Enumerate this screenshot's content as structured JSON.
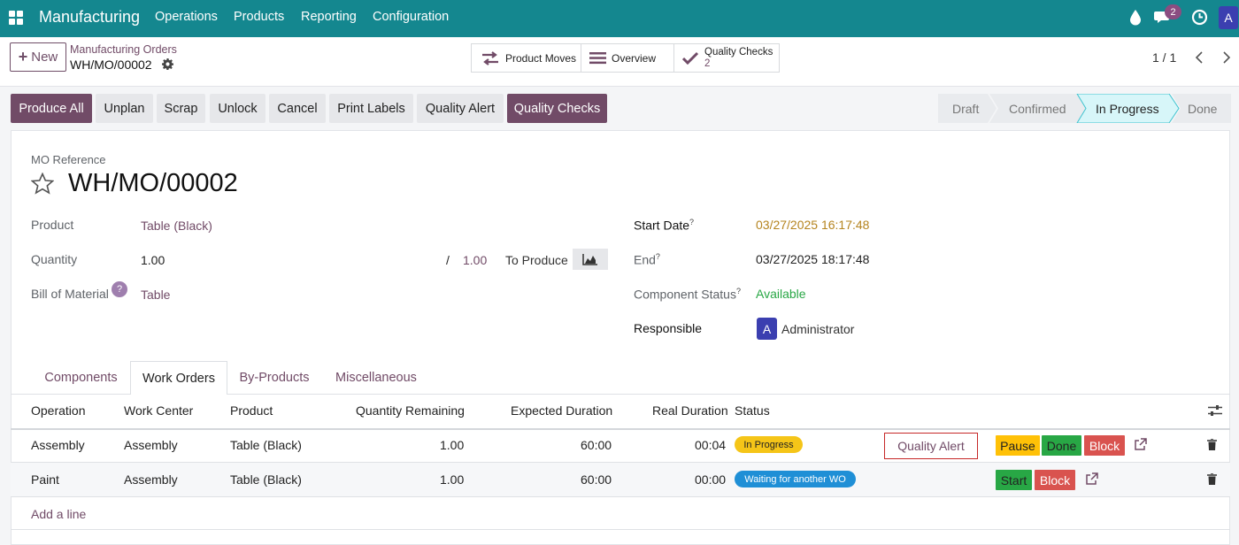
{
  "topbar": {
    "app_name": "Manufacturing",
    "menu": [
      "Operations",
      "Products",
      "Reporting",
      "Configuration"
    ],
    "messages_badge": "2",
    "user_initial": "A"
  },
  "control_panel": {
    "new_label": "New",
    "breadcrumb_parent": "Manufacturing Orders",
    "breadcrumb_current": "WH/MO/00002",
    "smart_buttons": {
      "product_moves": "Product Moves",
      "overview": "Overview",
      "quality_checks": "Quality Checks",
      "quality_checks_count": "2"
    },
    "pager": "1 / 1"
  },
  "action_buttons": [
    "Produce All",
    "Unplan",
    "Scrap",
    "Unlock",
    "Cancel",
    "Print Labels",
    "Quality Alert",
    "Quality Checks"
  ],
  "statusbar": {
    "stages": [
      "Draft",
      "Confirmed",
      "In Progress",
      "Done"
    ],
    "active": "In Progress"
  },
  "form": {
    "ref_label": "MO Reference",
    "ref_value": "WH/MO/00002",
    "product_label": "Product",
    "product_value": "Table (Black)",
    "quantity_label": "Quantity",
    "quantity_value": "1.00",
    "quantity_slash": "/",
    "quantity_total": "1.00",
    "to_produce_label": "To Produce",
    "bom_label": "Bill of Material",
    "bom_help": "?",
    "bom_value": "Table",
    "start_date_label": "Start Date",
    "start_date_value": "03/27/2025 16:17:48",
    "end_label": "End",
    "end_value": "03/27/2025 18:17:48",
    "component_status_label": "Component Status",
    "component_status_value": "Available",
    "responsible_label": "Responsible",
    "responsible_initial": "A",
    "responsible_value": "Administrator",
    "help_mark": "?"
  },
  "tabs": [
    "Components",
    "Work Orders",
    "By-Products",
    "Miscellaneous"
  ],
  "active_tab": "Work Orders",
  "table": {
    "headers": [
      "Operation",
      "Work Center",
      "Product",
      "Quantity Remaining",
      "Expected Duration",
      "Real Duration",
      "Status"
    ],
    "rows": [
      {
        "operation": "Assembly",
        "work_center": "Assembly",
        "product": "Table (Black)",
        "qty": "1.00",
        "expected": "60:00",
        "real": "00:04",
        "status": "In Progress",
        "quality_alert": "Quality Alert",
        "actions": [
          "Pause",
          "Done",
          "Block"
        ]
      },
      {
        "operation": "Paint",
        "work_center": "Assembly",
        "product": "Table (Black)",
        "qty": "1.00",
        "expected": "60:00",
        "real": "00:00",
        "status": "Waiting for another WO",
        "actions": [
          "Start",
          "Block"
        ]
      }
    ],
    "add_line": "Add a line"
  },
  "colors": {
    "topbar": "#14878f",
    "primary": "#714b67",
    "in_progress_pill": "#f5c518",
    "waiting_pill": "#1f8fd6",
    "done_green": "#28a745",
    "block_red": "#d9534f",
    "pause_yellow": "#ffc107",
    "start_date_orange": "#b5841f",
    "available_green": "#28a745",
    "quality_alert_border": "#c62828"
  },
  "icons": [
    "apps-icon",
    "droplet-icon",
    "chat-icon",
    "clock-icon",
    "gear-icon",
    "transfer-arrows-icon",
    "list-icon",
    "check-icon",
    "chevron-left-icon",
    "chevron-right-icon",
    "star-icon",
    "forecast-chart-icon",
    "settings-sliders-icon",
    "external-link-icon",
    "trash-icon"
  ]
}
